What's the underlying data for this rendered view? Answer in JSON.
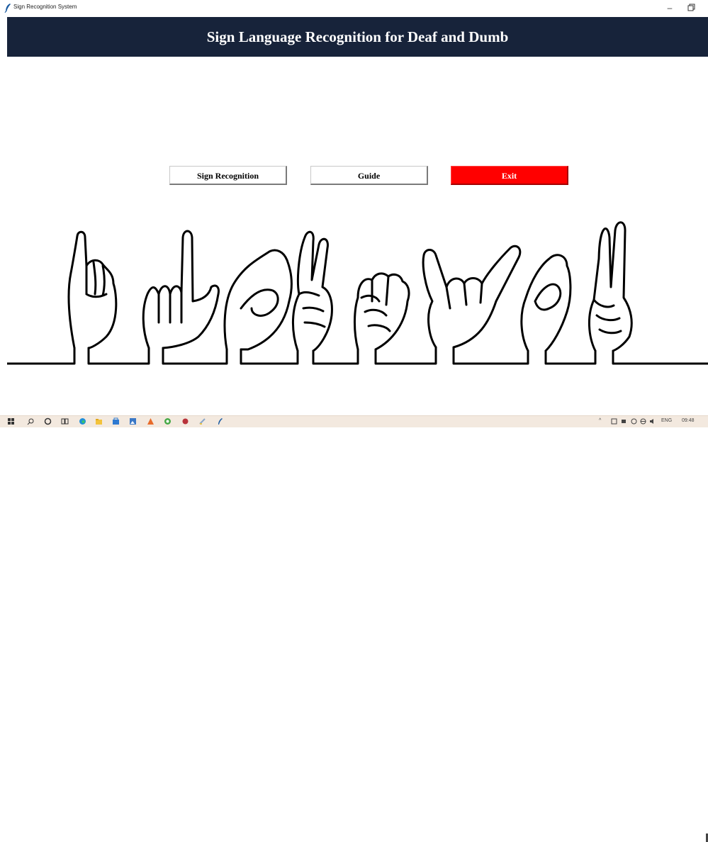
{
  "window": {
    "title": "Sign Recognition System",
    "minimize_glyph": "–",
    "maximize_icon": "restore-icon"
  },
  "header": {
    "title": "Sign Language Recognition for Deaf and Dumb",
    "background": "#17233a"
  },
  "buttons": {
    "sign_recognition": "Sign Recognition",
    "guide": "Guide",
    "exit": "Exit",
    "exit_color": "#ff0000"
  },
  "illustration": {
    "icon": "sign-language-hands-illustration"
  },
  "taskbar": {
    "icons": [
      "windows-start-icon",
      "search-icon",
      "cortana-icon",
      "task-view-icon",
      "edge-icon",
      "file-explorer-icon",
      "store-icon",
      "photos-icon",
      "app-icon",
      "chrome-icon",
      "app-icon",
      "python-idle-icon",
      "feather-icon"
    ],
    "tray": {
      "language": "ENG",
      "time": "09:48"
    }
  }
}
